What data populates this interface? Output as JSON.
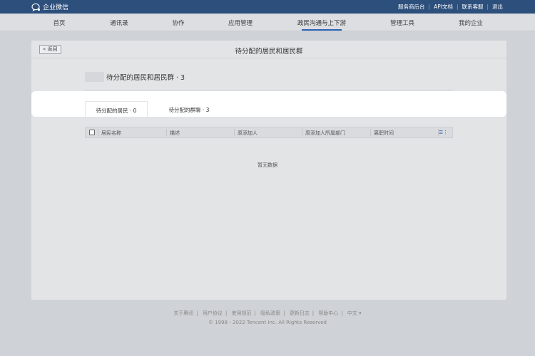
{
  "topbar": {
    "app_name": "企业微信",
    "links": [
      "服务商后台",
      "API文档",
      "联系客服",
      "退出"
    ]
  },
  "nav": {
    "items": [
      "首页",
      "通讯录",
      "协作",
      "应用管理",
      "政民沟通与上下游",
      "管理工具",
      "我的企业"
    ],
    "active_index": 4
  },
  "panel": {
    "back_label": "« 返回",
    "title": "待分配的居民和居民群",
    "sub_title": "待分配的居民和居民群 · 3"
  },
  "tabs": [
    {
      "label": "待分配的居民 · 0",
      "active": true
    },
    {
      "label": "待分配的群聊 · 3",
      "active": false
    }
  ],
  "table": {
    "columns": [
      "居民名称",
      "描述",
      "原添加人",
      "原添加人所属部门",
      "离职时间"
    ],
    "column_menu_icon": "list-settings-icon",
    "empty_text": "暂无数据"
  },
  "footer": {
    "links": [
      "关于腾讯",
      "用户协议",
      "使用规范",
      "隐私政策",
      "更新日志",
      "帮助中心",
      "中文 ▾"
    ],
    "copyright": "© 1998 - 2022 Tencent Inc. All Rights Reserved"
  },
  "colors": {
    "topbar": "#2c4f7c",
    "accent": "#2c63b5"
  }
}
